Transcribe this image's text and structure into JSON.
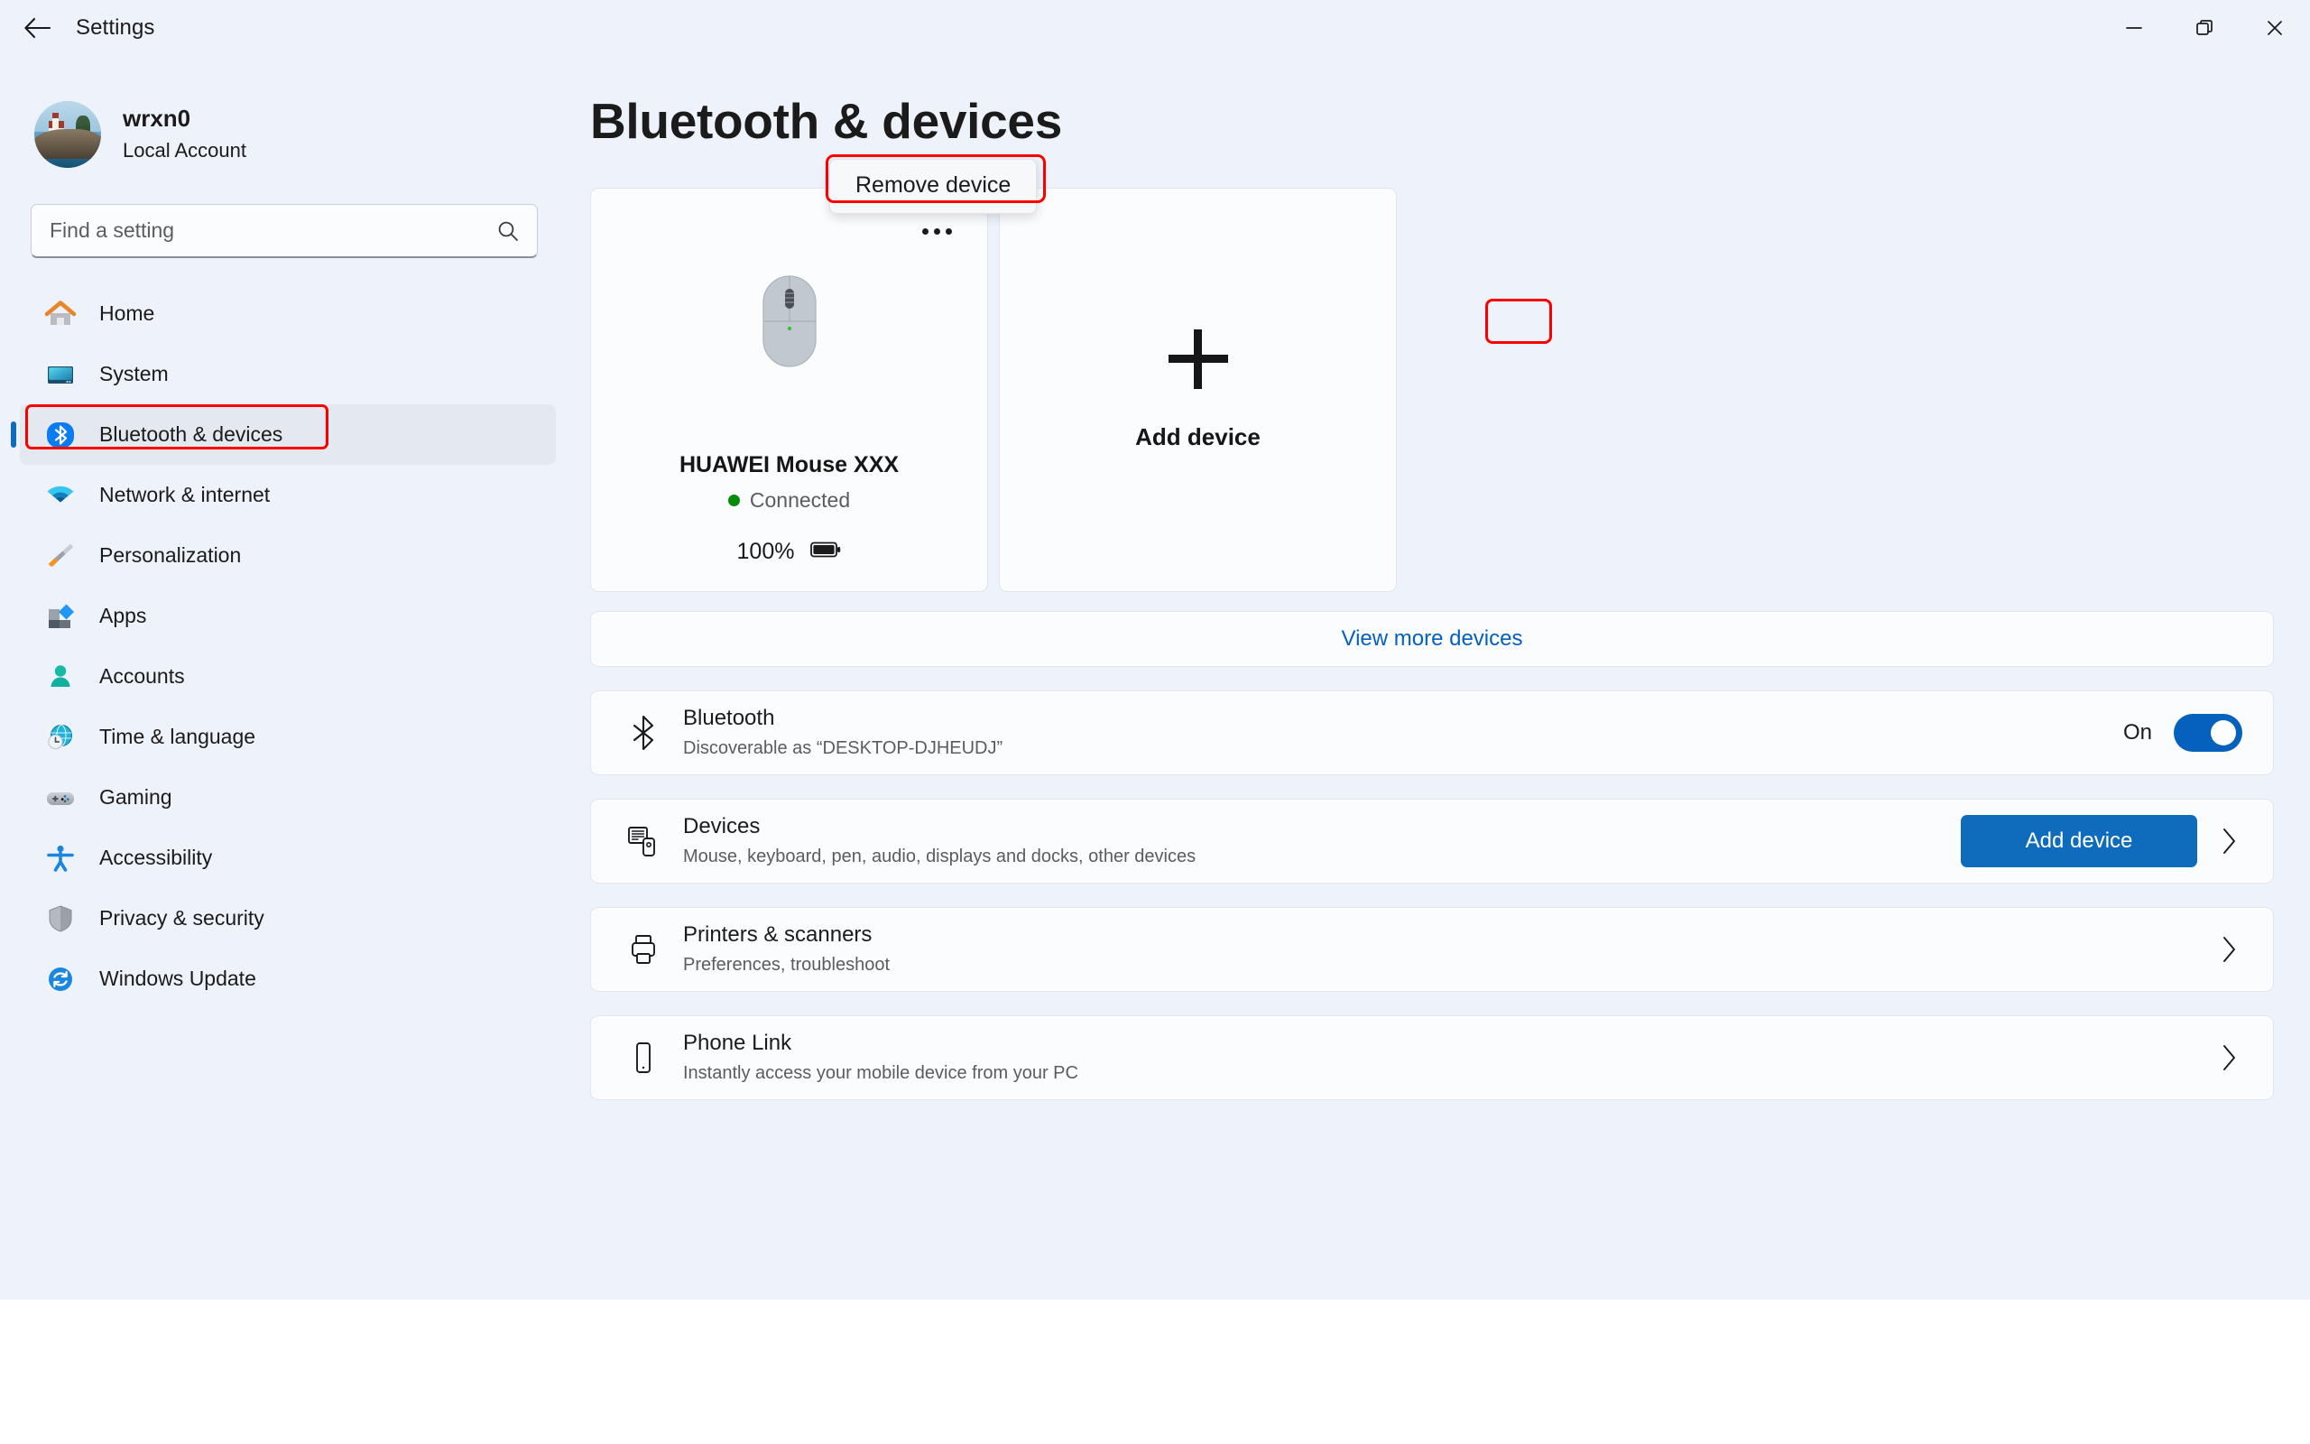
{
  "titlebar": {
    "title": "Settings",
    "back_icon": "back-arrow-icon",
    "minimize_icon": "minimize-icon",
    "restore_icon": "restore-icon",
    "close_icon": "close-icon"
  },
  "account": {
    "name": "wrxn0",
    "type": "Local Account",
    "avatar_alt": "lighthouse-photo-avatar"
  },
  "search": {
    "placeholder": "Find a setting",
    "value": "",
    "icon": "search-icon"
  },
  "sidebar": {
    "items": [
      {
        "label": "Home",
        "icon": "home-icon",
        "selected": false
      },
      {
        "label": "System",
        "icon": "system-monitor-icon",
        "selected": false
      },
      {
        "label": "Bluetooth & devices",
        "icon": "bluetooth-icon",
        "selected": true
      },
      {
        "label": "Network & internet",
        "icon": "wifi-icon",
        "selected": false
      },
      {
        "label": "Personalization",
        "icon": "paintbrush-icon",
        "selected": false
      },
      {
        "label": "Apps",
        "icon": "apps-icon",
        "selected": false
      },
      {
        "label": "Accounts",
        "icon": "person-icon",
        "selected": false
      },
      {
        "label": "Time & language",
        "icon": "clock-globe-icon",
        "selected": false
      },
      {
        "label": "Gaming",
        "icon": "gamepad-icon",
        "selected": false
      },
      {
        "label": "Accessibility",
        "icon": "accessibility-person-icon",
        "selected": false
      },
      {
        "label": "Privacy & security",
        "icon": "shield-icon",
        "selected": false
      },
      {
        "label": "Windows Update",
        "icon": "refresh-circle-icon",
        "selected": false
      }
    ]
  },
  "main": {
    "page_title": "Bluetooth & devices",
    "tooltip": "Remove device",
    "device_card": {
      "more_icon": "ellipsis-icon",
      "device_icon": "mouse-icon",
      "name": "HUAWEI Mouse XXX",
      "status": "Connected",
      "battery_percent": "100%",
      "battery_icon": "battery-full-icon"
    },
    "add_device_card": {
      "plus_icon": "plus-icon",
      "label": "Add device"
    },
    "view_more_link": "View more devices",
    "rows": [
      {
        "id": "bluetooth",
        "icon": "bluetooth-outline-icon",
        "title": "Bluetooth",
        "subtitle": "Discoverable as “DESKTOP-DJHEUDJ”",
        "toggle_label": "On",
        "toggle_state": "on"
      },
      {
        "id": "devices",
        "icon": "devices-icon",
        "title": "Devices",
        "subtitle": "Mouse, keyboard, pen, audio, displays and docks, other devices",
        "button_label": "Add device",
        "chevron_icon": "chevron-right-icon"
      },
      {
        "id": "printers",
        "icon": "printer-icon",
        "title": "Printers & scanners",
        "subtitle": "Preferences, troubleshoot",
        "chevron_icon": "chevron-right-icon"
      },
      {
        "id": "phone-link",
        "icon": "phone-icon",
        "title": "Phone Link",
        "subtitle": "Instantly access your mobile device from your PC",
        "chevron_icon": "chevron-right-icon"
      }
    ]
  },
  "colors": {
    "accent": "#0f6cbd",
    "link": "#0560be",
    "annotation": "#fc0000",
    "connected": "#0a8a0a",
    "window_bg": "#eef2fa",
    "card_bg": "#fbfcfe"
  }
}
